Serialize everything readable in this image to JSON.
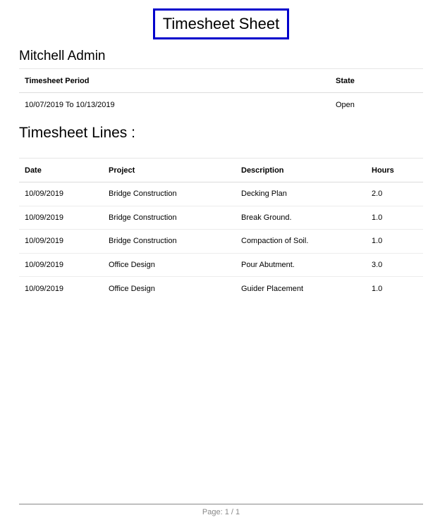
{
  "report": {
    "title": "Timesheet Sheet",
    "employee_name": "Mitchell Admin"
  },
  "period_table": {
    "headers": {
      "period": "Timesheet Period",
      "state": "State"
    },
    "row": {
      "period": "10/07/2019 To 10/13/2019",
      "state": "Open"
    }
  },
  "lines_section": {
    "title": "Timesheet Lines :"
  },
  "lines_table": {
    "headers": {
      "date": "Date",
      "project": "Project",
      "description": "Description",
      "hours": "Hours"
    },
    "rows": [
      {
        "date": "10/09/2019",
        "project": "Bridge Construction",
        "description": "Decking Plan",
        "hours": "2.0"
      },
      {
        "date": "10/09/2019",
        "project": "Bridge Construction",
        "description": "Break Ground.",
        "hours": "1.0"
      },
      {
        "date": "10/09/2019",
        "project": "Bridge Construction",
        "description": "Compaction of Soil.",
        "hours": "1.0"
      },
      {
        "date": "10/09/2019",
        "project": "Office Design",
        "description": "Pour Abutment.",
        "hours": "3.0"
      },
      {
        "date": "10/09/2019",
        "project": "Office Design",
        "description": "Guider Placement",
        "hours": "1.0"
      }
    ]
  },
  "footer": {
    "page_label": "Page: 1 / 1"
  },
  "colors": {
    "title_border": "#0000cc",
    "footer_text": "#888888"
  }
}
